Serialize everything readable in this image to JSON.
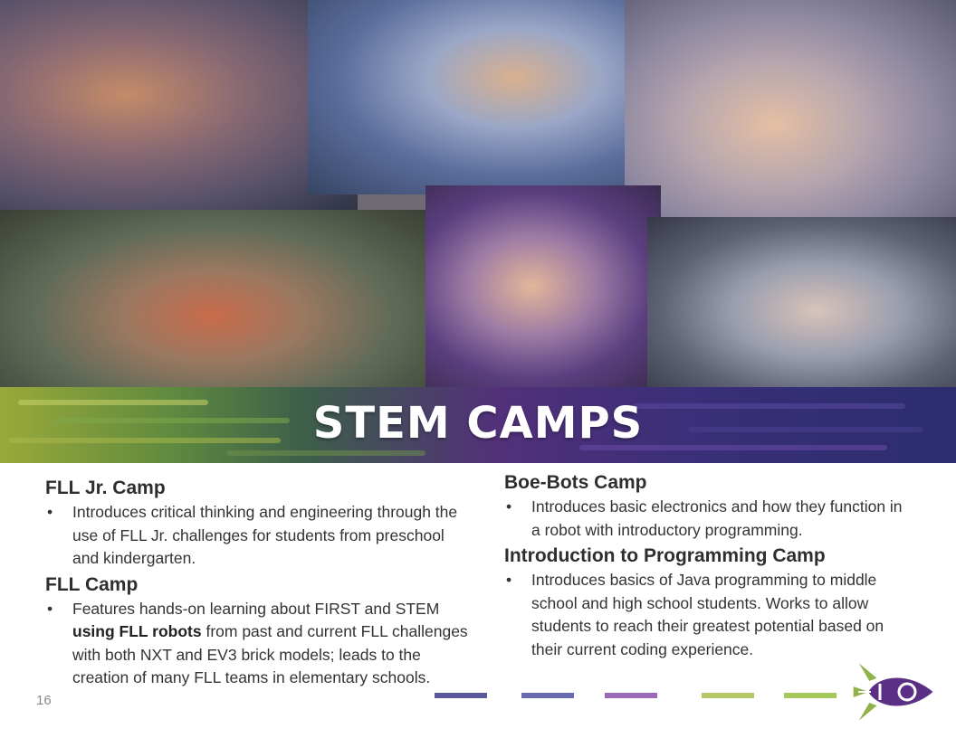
{
  "collage": {
    "photos": [
      {
        "name": "photo-kids-building-robots"
      },
      {
        "name": "photo-boy-with-lego-robot"
      },
      {
        "name": "photo-girls-drawing-map"
      },
      {
        "name": "photo-campers-group-seated"
      },
      {
        "name": "photo-two-girls-smiling"
      },
      {
        "name": "photo-students-at-computers"
      }
    ]
  },
  "banner": {
    "title": "STEM CAMPS"
  },
  "left_column": {
    "sections": [
      {
        "heading": "FLL Jr. Camp",
        "bullet_parts": [
          "Introduces critical thinking and engineering through the use of FLL Jr. challenges for students from preschool and kindergarten."
        ]
      },
      {
        "heading": "FLL Camp",
        "bullet_parts": [
          "Features hands-on learning about FIRST and STEM ",
          "using FLL robots",
          " from past and current FLL challenges with both NXT and EV3 brick models; leads to the creation of many FLL teams in elementary schools."
        ]
      }
    ]
  },
  "right_column": {
    "sections": [
      {
        "heading": "Boe-Bots Camp",
        "bullet": "Introduces basic electronics and how they function in a robot with introductory programming."
      },
      {
        "heading": "Introduction to Programming Camp",
        "bullet": "Introduces basics of Java programming to middle school and high school students. Works to allow students to reach their greatest potential based on their current coding experience."
      }
    ]
  },
  "page_number": "16",
  "footer": {
    "bar_colors": [
      "#5a5a9a",
      "#6a6ab0",
      "#9a6ab8",
      "#b4c86a",
      "#a4c85a"
    ],
    "logo_icon": "rocket-logo-icon",
    "logo_colors": {
      "body": "#5b2f86",
      "fins": "#8fb24a",
      "outline": "#ffffff"
    }
  }
}
